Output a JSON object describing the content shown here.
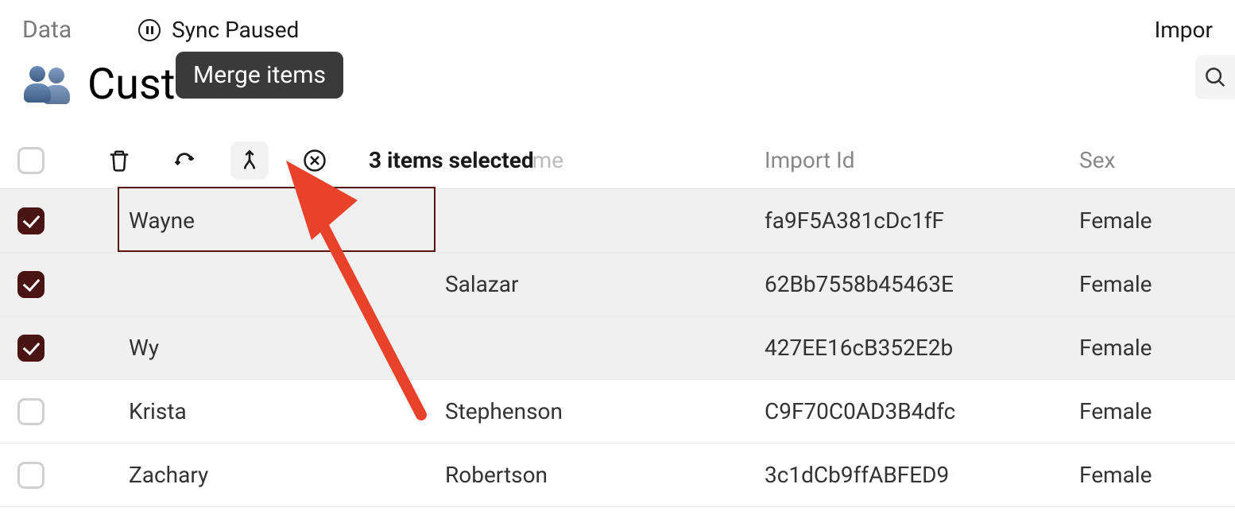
{
  "topbar": {
    "tab": "Data",
    "sync_status": "Sync Paused",
    "import_link": "Impor"
  },
  "header": {
    "title": "Cust",
    "tooltip": "Merge items"
  },
  "toolbar": {
    "selection_text": "3 items selected",
    "ghost_header": "me"
  },
  "columns": {
    "lastname": "Last Name",
    "importid": "Import Id",
    "sex": "Sex"
  },
  "rows": [
    {
      "checked": true,
      "firstname": "Wayne",
      "lastname": "",
      "importid": "fa9F5A381cDc1fF",
      "sex": "Female",
      "focused": true
    },
    {
      "checked": true,
      "firstname": "",
      "lastname": "Salazar",
      "importid": "62Bb7558b45463E",
      "sex": "Female",
      "focused": false
    },
    {
      "checked": true,
      "firstname": "Wy",
      "lastname": "",
      "importid": "427EE16cB352E2b",
      "sex": "Female",
      "focused": false
    },
    {
      "checked": false,
      "firstname": "Krista",
      "lastname": "Stephenson",
      "importid": "C9F70C0AD3B4dfc",
      "sex": "Female",
      "focused": false
    },
    {
      "checked": false,
      "firstname": "Zachary",
      "lastname": "Robertson",
      "importid": "3c1dCb9ffABFED9",
      "sex": "Female",
      "focused": false
    }
  ]
}
